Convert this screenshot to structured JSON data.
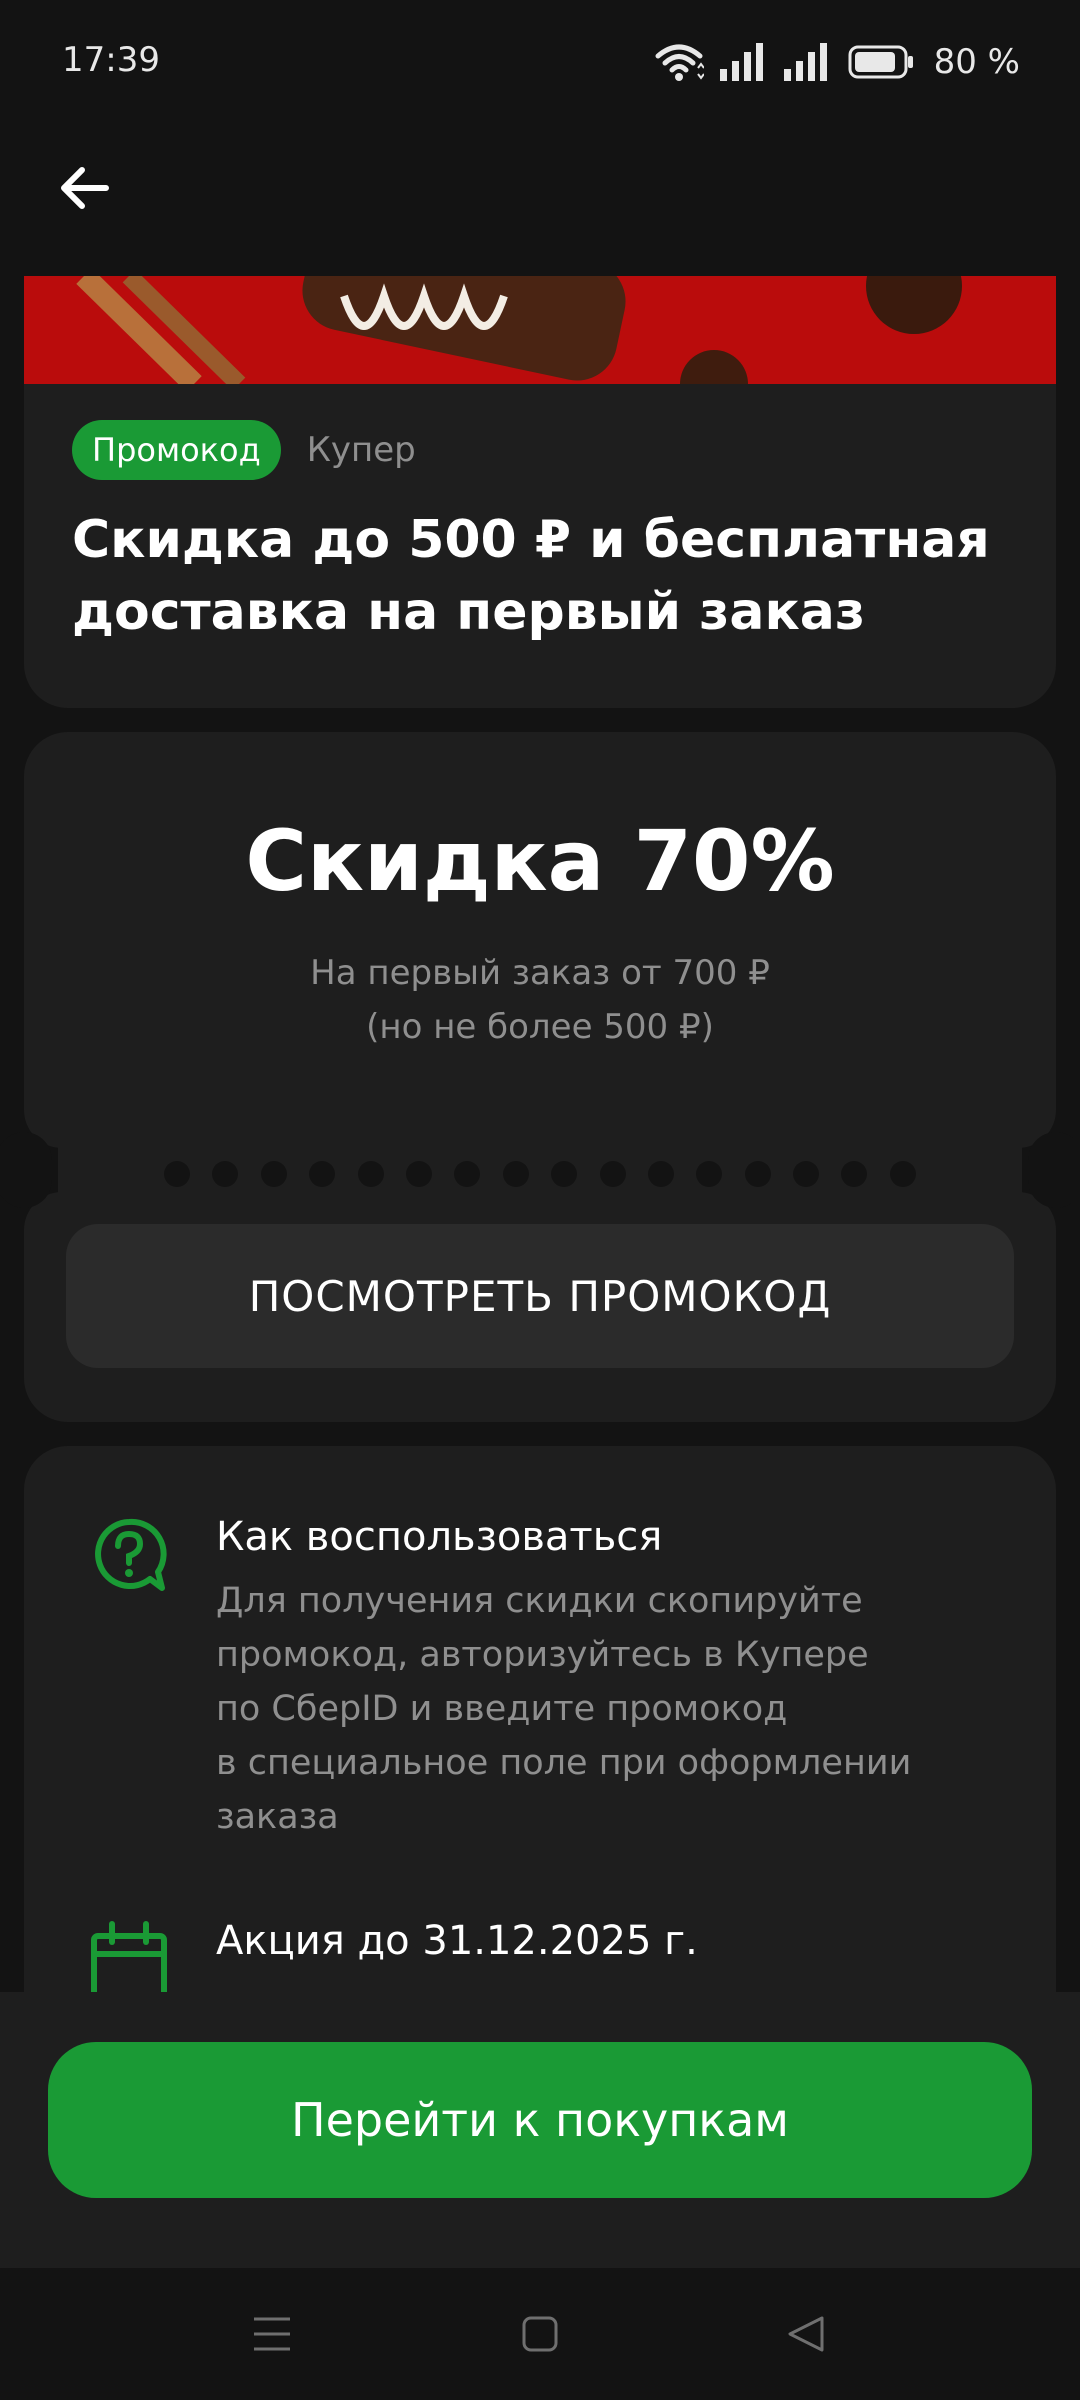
{
  "status_bar": {
    "time": "17:39",
    "battery_level": "80 %",
    "icons": [
      "wifi-icon",
      "signal-icon",
      "signal-icon",
      "battery-icon"
    ]
  },
  "nav": {
    "back_icon": "arrow-left-icon"
  },
  "hero": {
    "badge": "Промокод",
    "partner": "Купер",
    "title": "Скидка до 500 ₽ и бесплатная доставка на первый заказ"
  },
  "offer": {
    "title": "Скидка 70%",
    "subtitle_line1": "На первый заказ от 700 ₽",
    "subtitle_line2": "(но не более 500 ₽)",
    "show_promo_label": "ПОСМОТРЕТЬ ПРОМОКОД"
  },
  "info": {
    "how_to": {
      "icon": "question-bubble-icon",
      "title": "Как воспользоваться",
      "text_lines": [
        "Для получения скидки скопируйте",
        "промокод, авторизуйтесь в Купере",
        "по СберID и введите промокод",
        "в специальное поле при оформлении",
        "заказа"
      ]
    },
    "deadline": {
      "icon": "calendar-icon",
      "title": "Акция до 31.12.2025 г."
    }
  },
  "actions": {
    "go_shopping_label": "Перейти к покупкам"
  },
  "system_nav": {
    "icons": [
      "menu-icon",
      "home-icon",
      "back-triangle-icon"
    ]
  },
  "colors": {
    "background": "#131313",
    "card": "#1e1e1e",
    "accent_green": "#1a9a35",
    "muted_text": "#8f8f8f"
  }
}
